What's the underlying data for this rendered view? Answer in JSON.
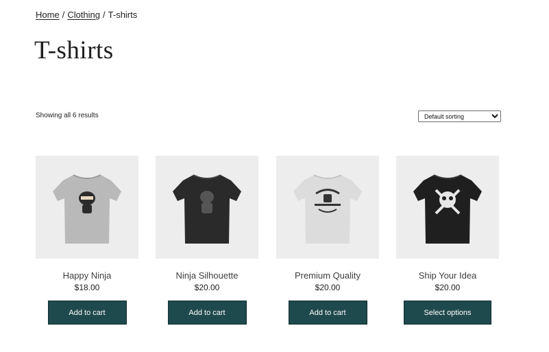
{
  "breadcrumb": {
    "home": "Home",
    "clothing": "Clothing",
    "current": "T-shirts",
    "separator": "/"
  },
  "page": {
    "title": "T-shirts"
  },
  "toolbar": {
    "result_count": "Showing all 6 results",
    "sort_selected": "Default sorting"
  },
  "products": [
    {
      "name": "Happy Ninja",
      "price": "$18.00",
      "button": "Add to cart",
      "shirt_color": "#b9b9b9"
    },
    {
      "name": "Ninja Silhouette",
      "price": "$20.00",
      "button": "Add to cart",
      "shirt_color": "#2a2a2a"
    },
    {
      "name": "Premium Quality",
      "price": "$20.00",
      "button": "Add to cart",
      "shirt_color": "#dcdcdc"
    },
    {
      "name": "Ship Your Idea",
      "price": "$20.00",
      "button": "Select options",
      "shirt_color": "#1f1f1f"
    }
  ],
  "colors": {
    "button_bg": "#1f4a4d",
    "thumb_bg": "#ededed"
  }
}
